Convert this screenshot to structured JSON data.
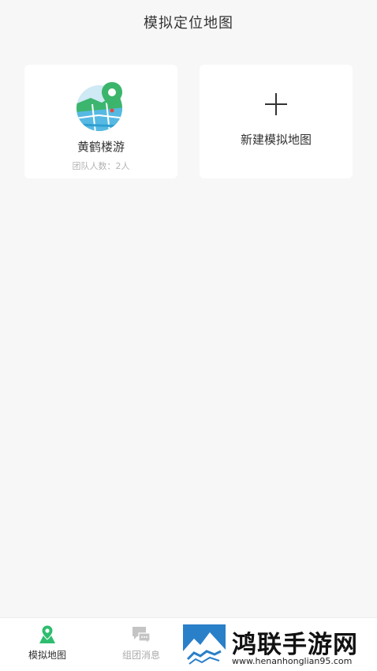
{
  "header": {
    "title": "模拟定位地图"
  },
  "maps": [
    {
      "name": "黄鹤楼游",
      "team_count": "团队人数：2人"
    }
  ],
  "new_map": {
    "label": "新建模拟地图"
  },
  "tabbar": {
    "tabs": [
      {
        "label": "模拟地图",
        "active": true,
        "icon": "map-pin-icon"
      },
      {
        "label": "组团消息",
        "active": false,
        "icon": "chat-icon"
      }
    ]
  },
  "watermark": {
    "text": "鸿联手游网",
    "url": "www.henanhonglian95.com"
  },
  "colors": {
    "accent": "#2dbd6e",
    "background": "#f7f7f7",
    "inactive": "#aaaaaa"
  }
}
